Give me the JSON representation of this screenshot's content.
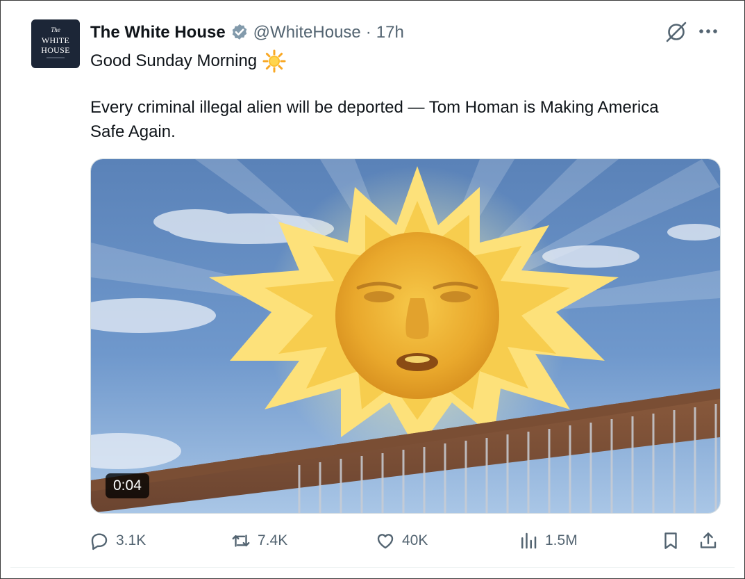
{
  "author": {
    "display_name": "The White House",
    "handle": "@WhiteHouse",
    "separator": "·",
    "time": "17h",
    "avatar_text": {
      "small": "The",
      "line1": "WHITE",
      "line2": "HOUSE"
    },
    "badge_color": "#829aab"
  },
  "post": {
    "line1": "Good Sunday Morning",
    "line1_emoji": "sun-emoji",
    "line2": "Every criminal illegal alien will be deported — Tom Homan is Making America",
    "line3": "Safe Again."
  },
  "media": {
    "type": "video",
    "duration": "0:04",
    "description_icons": [
      "sun-face",
      "border-wall",
      "sky-with-clouds"
    ]
  },
  "actions": {
    "replies": "3.1K",
    "reposts": "7.4K",
    "likes": "40K",
    "views": "1.5M"
  },
  "icons": [
    "verified-badge-icon",
    "grok-icon",
    "more-icon",
    "reply-icon",
    "repost-icon",
    "like-icon",
    "views-icon",
    "bookmark-icon",
    "share-icon"
  ],
  "colors": {
    "text": "#0f1419",
    "secondary": "#536471",
    "sun": "#fdbf2d"
  }
}
